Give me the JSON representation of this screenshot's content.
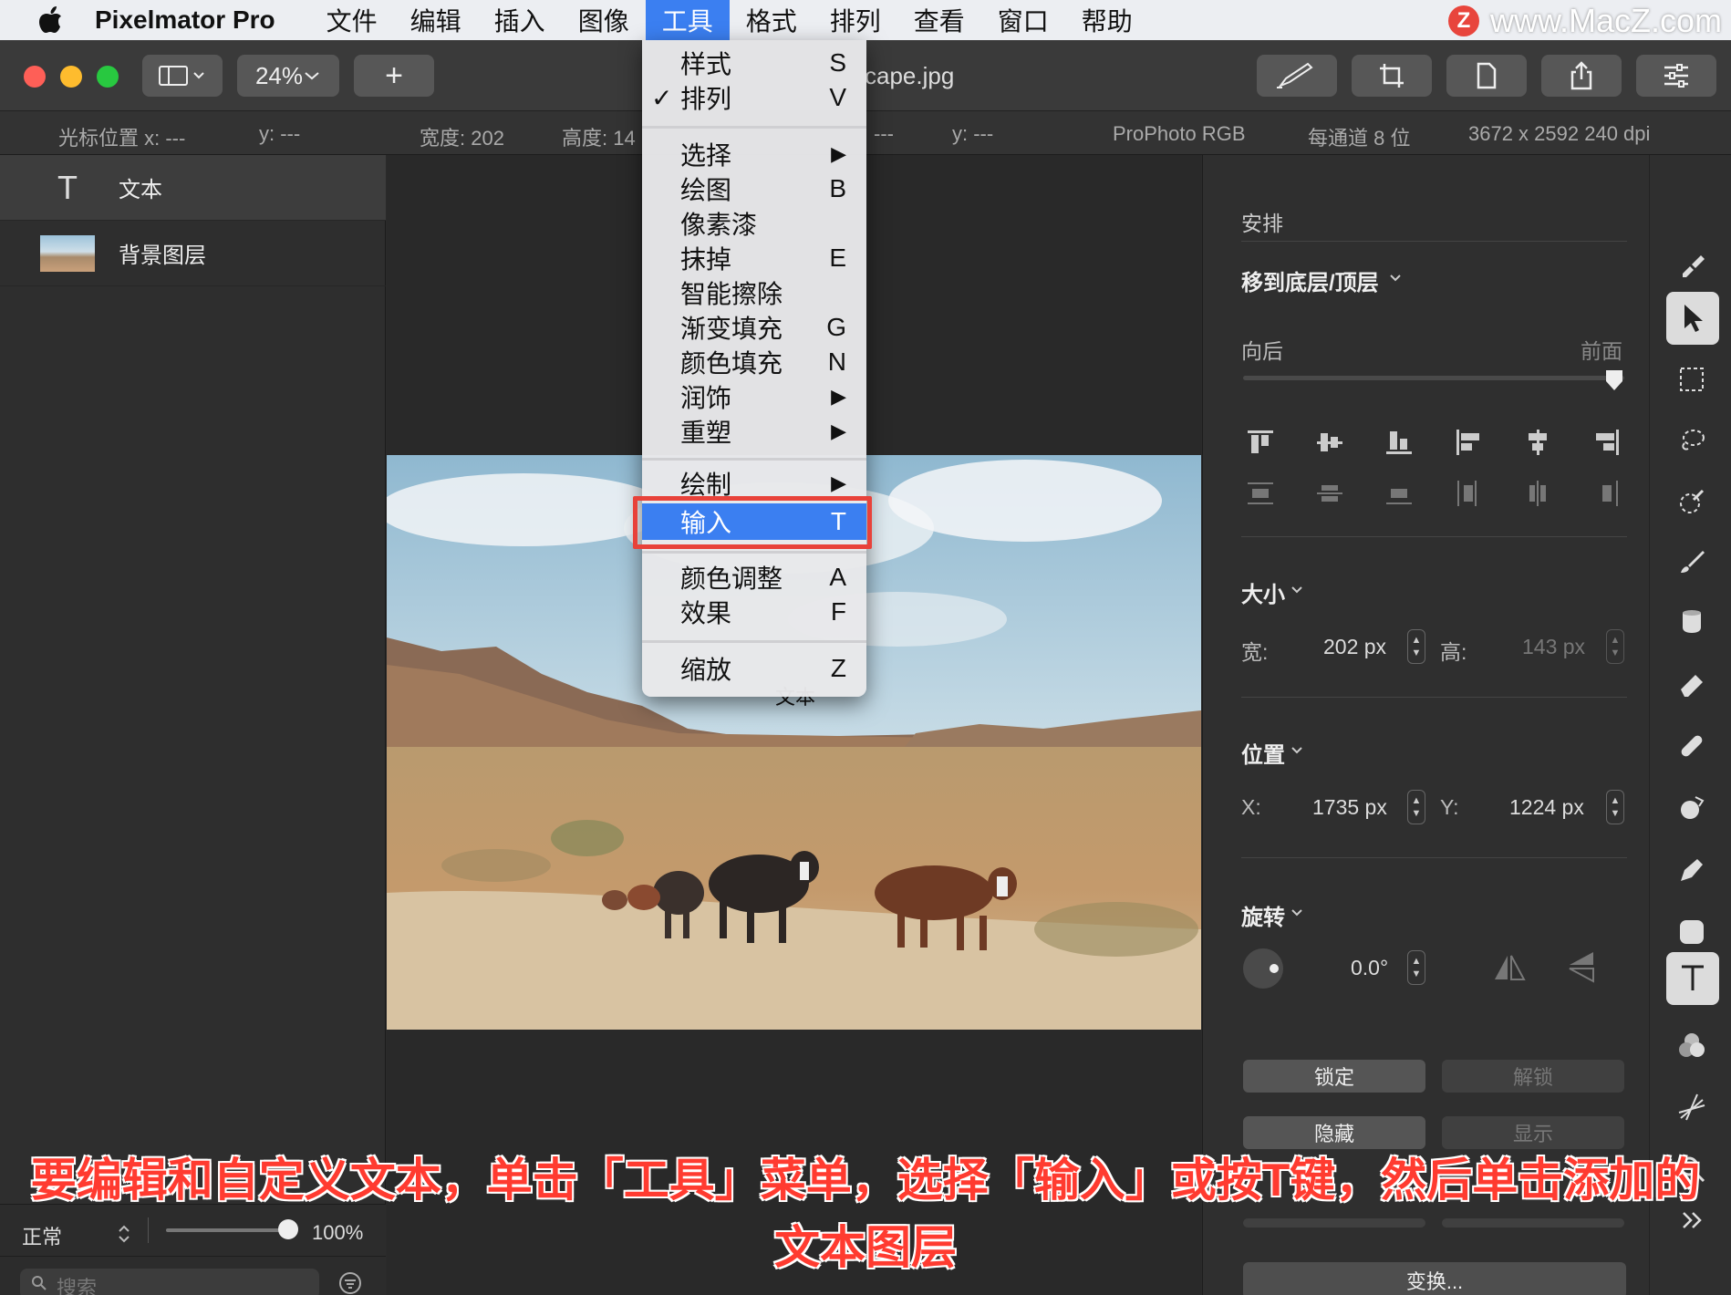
{
  "menubar": {
    "app_name": "Pixelmator Pro",
    "items": [
      "文件",
      "编辑",
      "插入",
      "图像",
      "工具",
      "格式",
      "排列",
      "查看",
      "窗口",
      "帮助"
    ],
    "active_item": "工具",
    "watermark": "www.MacZ.com",
    "watermark_logo": "Z"
  },
  "toolbar": {
    "zoom": "24%",
    "add_label": "+",
    "doc_title": "cape.jpg"
  },
  "infobar": {
    "cursor_x": "光标位置 x:  ---",
    "cursor_y": "y:  ---",
    "width": "宽度:  202",
    "height": "高度:  14",
    "mid_dash": "---",
    "y2": "y:  ---",
    "colorspace": "ProPhoto RGB",
    "depth": "每通道 8 位",
    "dimensions": "3672 x 2592 240 dpi"
  },
  "layers": {
    "items": [
      {
        "icon": "T",
        "label": "文本"
      },
      {
        "icon": "thumb",
        "label": "背景图层"
      }
    ],
    "blend_mode": "正常",
    "opacity": "100%",
    "opacity_value": 1.0,
    "search_placeholder": "搜索"
  },
  "canvas": {
    "text_layer": "文本"
  },
  "menu": {
    "items": [
      {
        "label": "样式",
        "key": "S",
        "check": ""
      },
      {
        "label": "排列",
        "key": "V",
        "check": "✓"
      },
      {
        "label": "选择",
        "key": "▶",
        "check": ""
      },
      {
        "label": "绘图",
        "key": "B",
        "check": ""
      },
      {
        "label": "像素漆",
        "key": "",
        "check": ""
      },
      {
        "label": "抹掉",
        "key": "E",
        "check": ""
      },
      {
        "label": "智能擦除",
        "key": "",
        "check": ""
      },
      {
        "label": "渐变填充",
        "key": "G",
        "check": ""
      },
      {
        "label": "颜色填充",
        "key": "N",
        "check": ""
      },
      {
        "label": "润饰",
        "key": "▶",
        "check": ""
      },
      {
        "label": "重塑",
        "key": "▶",
        "check": ""
      },
      {
        "label": "绘制",
        "key": "▶",
        "check": ""
      },
      {
        "label": "输入",
        "key": "T",
        "check": ""
      },
      {
        "label": "颜色调整",
        "key": "A",
        "check": ""
      },
      {
        "label": "效果",
        "key": "F",
        "check": ""
      },
      {
        "label": "缩放",
        "key": "Z",
        "check": ""
      }
    ]
  },
  "inspector": {
    "section_title": "安排",
    "arrange_head": "移到底层/顶层",
    "back_label": "向后",
    "front_label": "前面",
    "arrange_value": 1.0,
    "size_head": "大小",
    "width_label": "宽:",
    "width_value": "202 px",
    "height_label": "高:",
    "height_value": "143 px",
    "position_head": "位置",
    "x_label": "X:",
    "x_value": "1735 px",
    "y_label": "Y:",
    "y_value": "1224 px",
    "rotate_head": "旋转",
    "rotate_value": "0.0°",
    "lock": "锁定",
    "unlock": "解锁",
    "hide": "隐藏",
    "show": "显示",
    "transform": "变换..."
  },
  "subtitle": {
    "line1": "要编辑和自定义文本，单击「工具」菜单，选择「输入」或按T键，然后单击添加的",
    "line2": "文本图层"
  }
}
